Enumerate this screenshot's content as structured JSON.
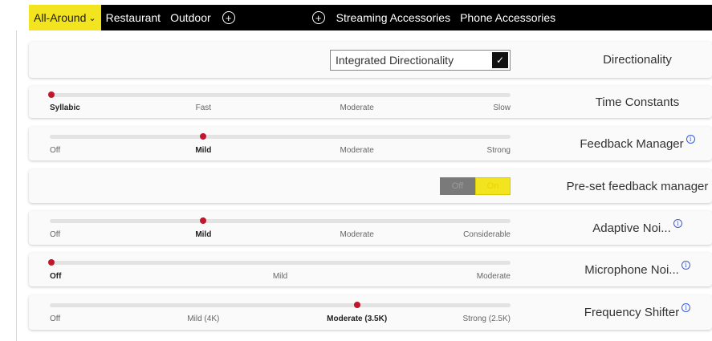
{
  "tabs": [
    {
      "label": "All-Around",
      "active": true
    },
    {
      "label": "Restaurant"
    },
    {
      "label": "Outdoor"
    },
    {
      "label": "Streaming Accessories"
    },
    {
      "label": "Phone Accessories"
    }
  ],
  "accent_color": "#f2e51f",
  "slider_dot_color": "#c0172e",
  "directionality": {
    "select_value": "Integrated Directionality",
    "label": "Directionality"
  },
  "time_constants": {
    "label": "Time Constants",
    "options": [
      "Syllabic",
      "Fast",
      "Moderate",
      "Slow"
    ],
    "selected": "Syllabic",
    "level": 0
  },
  "feedback_manager": {
    "label": "Feedback Manager",
    "options": [
      "Off",
      "Mild",
      "Moderate",
      "Strong"
    ],
    "selected": "Mild",
    "level": 0.333
  },
  "preset_feedback": {
    "label": "Pre-set feedback manager",
    "off_label": "Off",
    "on_label": "On",
    "state": "On"
  },
  "adaptive_noise": {
    "label": "Adaptive Noi...",
    "options": [
      "Off",
      "Mild",
      "Moderate",
      "Considerable"
    ],
    "selected": "Mild",
    "level": 0.333
  },
  "microphone_noise": {
    "label": "Microphone Noi...",
    "options": [
      "Off",
      "Mild",
      "Moderate"
    ],
    "selected": "Off",
    "level": 0
  },
  "frequency_shifter": {
    "label": "Frequency Shifter",
    "options": [
      "Off",
      "Mild (4K)",
      "Moderate (3.5K)",
      "Strong (2.5K)"
    ],
    "selected": "Moderate (3.5K)",
    "level": 0.667
  }
}
